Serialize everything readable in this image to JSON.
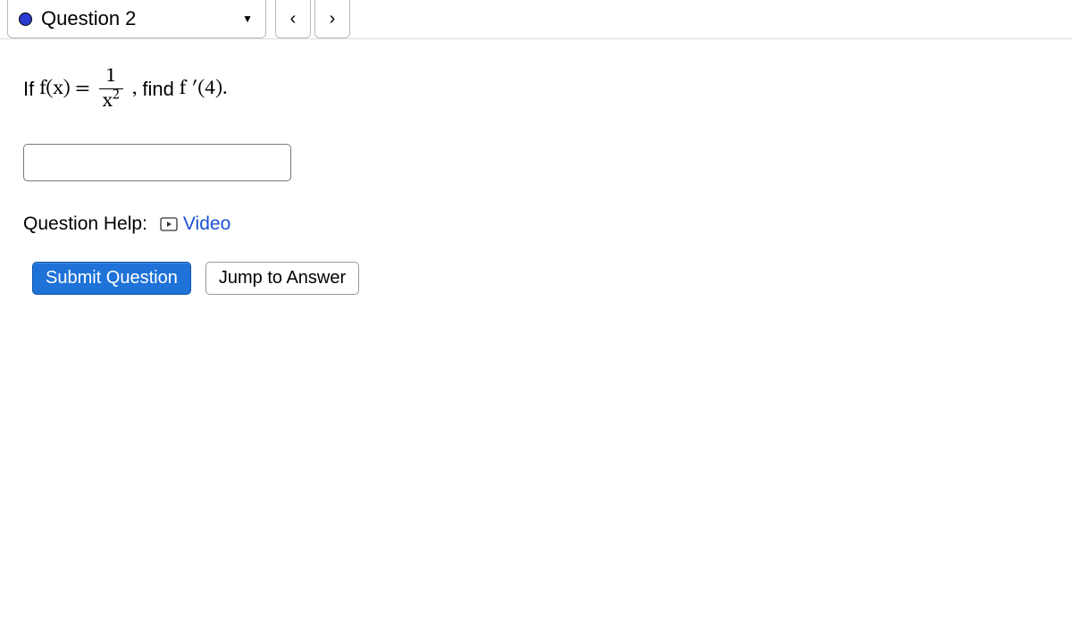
{
  "header": {
    "question_label": "Question 2"
  },
  "problem": {
    "if_text": "If ",
    "fx_lhs": "f(x) = ",
    "frac_num": "1",
    "frac_den_base": "x",
    "frac_den_exp": "2",
    "comma": ", ",
    "find_text": "find ",
    "fprime": "f ′(4).",
    "answer_value": ""
  },
  "help": {
    "label": "Question Help:",
    "video_label": "Video"
  },
  "buttons": {
    "submit": "Submit Question",
    "jump": "Jump to Answer"
  }
}
